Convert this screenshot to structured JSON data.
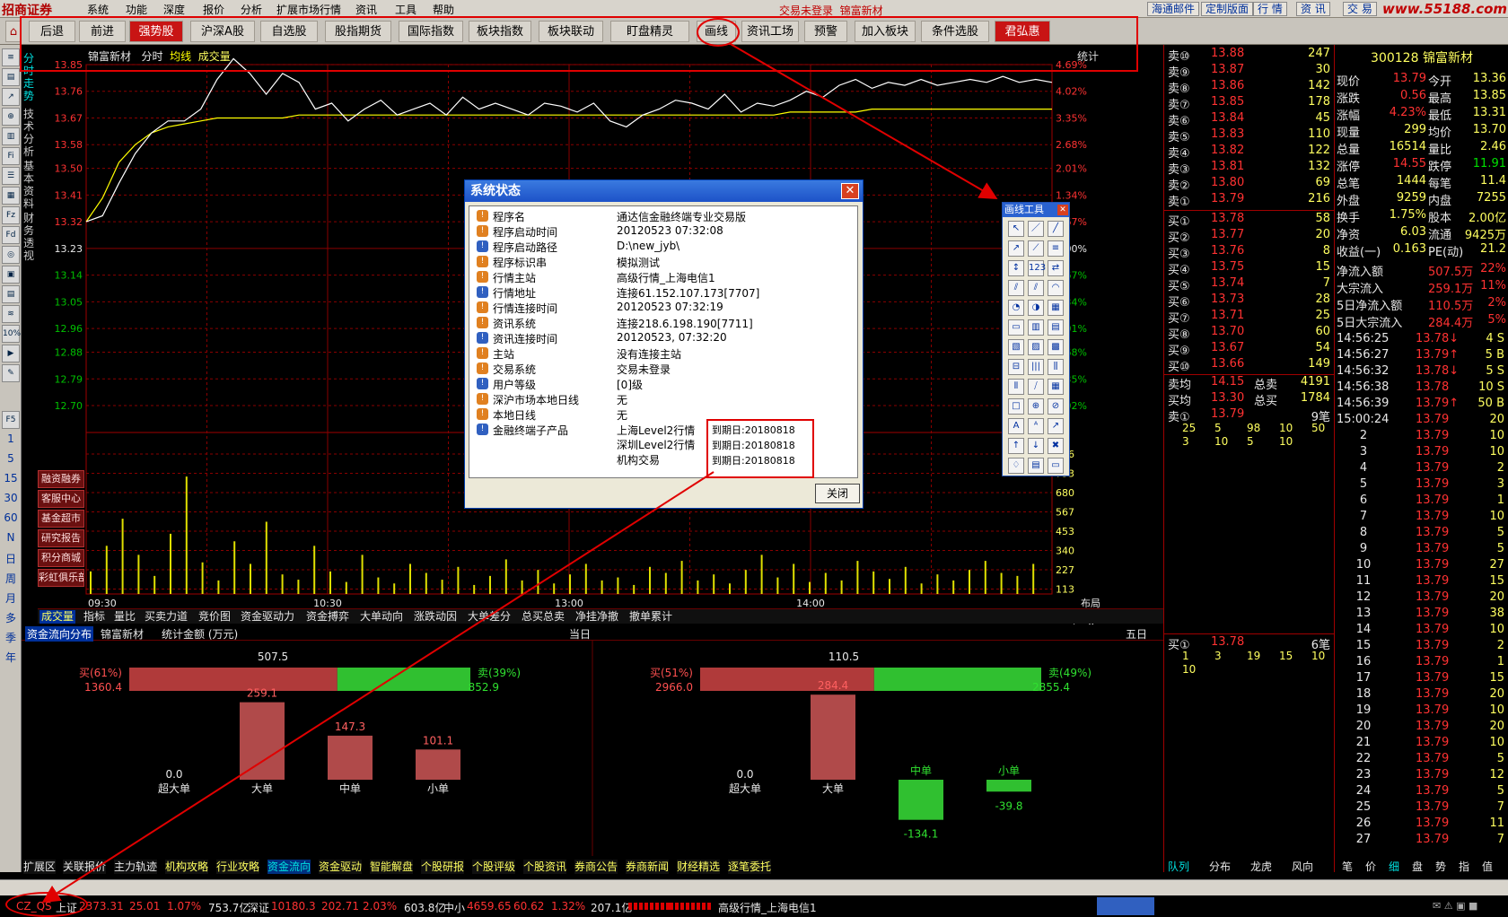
{
  "app": {
    "logo": "招商证券",
    "watermark": "www.55188.com",
    "trade_status": "交易未登录",
    "stock_title": "锦富新材"
  },
  "menu": [
    "系统",
    "功能",
    "深度",
    "报价",
    "分析",
    "扩展市场行情",
    "资讯",
    "工具",
    "帮助"
  ],
  "top_right_buttons": [
    "海通邮件",
    "定制版面",
    "行 情",
    "资 讯",
    "交 易"
  ],
  "toolbar": [
    "后退",
    "前进",
    "强势股",
    "沪深A股",
    "自选股",
    "股指期货",
    "国际指数",
    "板块指数",
    "板块联动",
    "盯盘精灵",
    "画线",
    "资讯工场",
    "预警",
    "加入板块",
    "条件选股",
    "君弘惠"
  ],
  "left_vertical_tabs": [
    "分时走势",
    "技术分析",
    "基本资料",
    "财务透视"
  ],
  "left_sidebar_letters": [
    "1",
    "5",
    "15",
    "30",
    "60",
    "N",
    "日",
    "周",
    "月",
    "多",
    "季",
    "年"
  ],
  "left_service_buttons": [
    "融资融券",
    "客服中心",
    "基金超市",
    "研究报告",
    "积分商城",
    "彩虹俱乐部"
  ],
  "chart_header": {
    "name": "锦富新材",
    "mode": "分时",
    "avg": "均线",
    "vol": "成交量",
    "stat": "统计"
  },
  "chart_data": {
    "type": "line",
    "price_ticks": [
      "13.85",
      "13.76",
      "13.67",
      "13.58",
      "13.50",
      "13.41",
      "13.32",
      "13.23",
      "13.14",
      "13.05",
      "12.96",
      "12.88",
      "12.79",
      "12.70"
    ],
    "pct_ticks": [
      "4.69%",
      "4.02%",
      "3.35%",
      "2.68%",
      "2.01%",
      "1.34%",
      "0.67%",
      "0.00%",
      "0.67%",
      "1.34%",
      "2.01%",
      "2.68%",
      "3.35%",
      "4.02%"
    ],
    "vol_ticks": [
      "906",
      "793",
      "680",
      "567",
      "453",
      "340",
      "227",
      "113"
    ],
    "x_ticks": [
      "09:30",
      "10:30",
      "13:00",
      "14:00"
    ],
    "layout_label": "布局",
    "price_y": [
      13.32,
      13.34,
      13.45,
      13.55,
      13.62,
      13.66,
      13.66,
      13.7,
      13.8,
      13.87,
      13.82,
      13.75,
      13.82,
      13.79,
      13.7,
      13.72,
      13.66,
      13.7,
      13.73,
      13.68,
      13.7,
      13.72,
      13.68,
      13.74,
      13.7,
      13.72,
      13.7,
      13.68,
      13.72,
      13.71,
      13.69,
      13.72,
      13.66,
      13.64,
      13.68,
      13.7,
      13.73,
      13.72,
      13.7,
      13.75,
      13.69,
      13.72,
      13.71,
      13.73,
      13.76,
      13.74,
      13.78,
      13.8,
      13.77,
      13.79,
      13.78,
      13.8,
      13.78,
      13.79,
      13.8,
      13.79,
      13.81,
      13.79,
      13.8,
      13.79
    ],
    "avg_y": [
      13.32,
      13.4,
      13.52,
      13.58,
      13.62,
      13.64,
      13.65,
      13.66,
      13.67,
      13.67,
      13.67,
      13.67,
      13.67,
      13.68,
      13.68,
      13.68,
      13.68,
      13.68,
      13.68,
      13.68,
      13.68,
      13.68,
      13.68,
      13.68,
      13.68,
      13.68,
      13.68,
      13.68,
      13.68,
      13.68,
      13.68,
      13.68,
      13.68,
      13.68,
      13.68,
      13.68,
      13.68,
      13.68,
      13.68,
      13.68,
      13.68,
      13.68,
      13.68,
      13.69,
      13.69,
      13.69,
      13.69,
      13.69,
      13.7,
      13.7,
      13.7,
      13.7,
      13.7,
      13.7,
      13.7,
      13.7,
      13.7,
      13.7,
      13.7,
      13.7
    ],
    "volume": [
      150,
      320,
      500,
      260,
      120,
      400,
      780,
      210,
      90,
      350,
      200,
      480,
      130,
      95,
      320,
      150,
      80,
      260,
      110,
      70,
      200,
      140,
      95,
      180,
      60,
      120,
      230,
      90,
      160,
      70,
      130,
      200,
      90,
      110,
      60,
      180,
      140,
      220,
      90,
      130,
      70,
      160,
      260,
      110,
      200,
      80,
      140,
      90,
      220,
      150,
      100,
      180,
      70,
      130,
      90,
      160,
      220,
      140,
      120,
      200
    ]
  },
  "indicator_tabs": [
    "成交量",
    "指标",
    "量比",
    "买卖力道",
    "竞价图",
    "资金驱动力",
    "资金搏弈",
    "大单动向",
    "涨跌动因",
    "大单差分",
    "总买总卖",
    "净挂净撤",
    "撤单累计"
  ],
  "fund_flow": {
    "header": [
      "资金流向分布",
      "锦富新材",
      "统计金额 (万元)"
    ],
    "today": "当日",
    "five_day": "五日",
    "panel1": {
      "top": "507.5",
      "buy_label": "买(61%)",
      "buy_val": "1360.4",
      "sell_label": "卖(39%)",
      "sell_val": "852.9",
      "buy_frac": 0.61,
      "cats": [
        "超大单",
        "大单",
        "中单",
        "小单"
      ],
      "vals": [
        "0.0",
        "259.1",
        "147.3",
        "101.1"
      ],
      "nums": [
        0,
        259.1,
        147.3,
        101.1
      ]
    },
    "panel2": {
      "top": "110.5",
      "buy_label": "买(51%)",
      "buy_val": "2966.0",
      "sell_label": "卖(49%)",
      "sell_val": "2855.4",
      "buy_frac": 0.51,
      "cats": [
        "超大单",
        "大单",
        "中单",
        "小单"
      ],
      "vals": [
        "0.0",
        "284.4",
        "-134.1",
        "-39.8"
      ],
      "nums": [
        0,
        284.4,
        -134.1,
        -39.8
      ]
    }
  },
  "bottom_tabs": [
    "扩展区",
    "关联报价",
    "主力轨迹",
    "机构攻略",
    "行业攻略",
    "资金流向",
    "资金驱动",
    "智能解盘",
    "个股研报",
    "个股评级",
    "个股资讯",
    "券商公告",
    "券商新闻",
    "财经精选",
    "逐笔委托"
  ],
  "order_book": {
    "asks": [
      [
        "卖⑩",
        "13.88",
        "247"
      ],
      [
        "卖⑨",
        "13.87",
        "30"
      ],
      [
        "卖⑧",
        "13.86",
        "142"
      ],
      [
        "卖⑦",
        "13.85",
        "178"
      ],
      [
        "卖⑥",
        "13.84",
        "45"
      ],
      [
        "卖⑤",
        "13.83",
        "110"
      ],
      [
        "卖④",
        "13.82",
        "122"
      ],
      [
        "卖③",
        "13.81",
        "132"
      ],
      [
        "卖②",
        "13.80",
        "69"
      ],
      [
        "卖①",
        "13.79",
        "216"
      ]
    ],
    "bids": [
      [
        "买①",
        "13.78",
        "58"
      ],
      [
        "买②",
        "13.77",
        "20"
      ],
      [
        "买③",
        "13.76",
        "8"
      ],
      [
        "买④",
        "13.75",
        "15"
      ],
      [
        "买⑤",
        "13.74",
        "7"
      ],
      [
        "买⑥",
        "13.73",
        "28"
      ],
      [
        "买⑦",
        "13.71",
        "25"
      ],
      [
        "买⑧",
        "13.70",
        "60"
      ],
      [
        "买⑨",
        "13.67",
        "54"
      ],
      [
        "买⑩",
        "13.66",
        "149"
      ]
    ],
    "avg_sell": [
      "卖均",
      "14.15",
      "总卖",
      "4191"
    ],
    "avg_buy": [
      "买均",
      "13.30",
      "总买",
      "1784"
    ],
    "sell1_row": [
      "卖①",
      "13.79",
      "9笔"
    ],
    "sell1_detail1": [
      "25",
      "5",
      "98",
      "10",
      "50"
    ],
    "sell1_detail2": [
      "3",
      "10",
      "5",
      "10"
    ],
    "buy1_row": [
      "买①",
      "13.78",
      "6笔"
    ],
    "buy1_detail1": [
      "1",
      "3",
      "19",
      "15",
      "10"
    ],
    "buy1_detail2": [
      "10"
    ]
  },
  "quote": {
    "code_name": "300128 锦富新材",
    "rows": [
      [
        "现价",
        "13.79",
        "今开",
        "13.36"
      ],
      [
        "涨跌",
        "0.56",
        "最高",
        "13.85"
      ],
      [
        "涨幅",
        "4.23%",
        "最低",
        "13.31"
      ],
      [
        "现量",
        "299",
        "均价",
        "13.70"
      ],
      [
        "总量",
        "16514",
        "量比",
        "2.46"
      ],
      [
        "涨停",
        "14.55",
        "跌停",
        "11.91"
      ],
      [
        "总笔",
        "1444",
        "每笔",
        "11.4"
      ],
      [
        "外盘",
        "9259",
        "内盘",
        "7255"
      ],
      [
        "换手",
        "1.75%",
        "股本",
        "2.00亿"
      ],
      [
        "净资",
        "6.03",
        "流通",
        "9425万"
      ],
      [
        "收益(一)",
        "0.163",
        "PE(动)",
        "21.2"
      ]
    ],
    "flow_rows": [
      [
        "净流入额",
        "507.5万",
        "22%"
      ],
      [
        "大宗流入",
        "259.1万",
        "11%"
      ],
      [
        "5日净流入额",
        "110.5万",
        "2%"
      ],
      [
        "5日大宗流入",
        "284.4万",
        "5%"
      ]
    ]
  },
  "ticks": [
    [
      "14:56:25",
      "13.78↓",
      "4 S"
    ],
    [
      "14:56:27",
      "13.79↑",
      "5 B"
    ],
    [
      "14:56:32",
      "13.78↓",
      "5 S"
    ],
    [
      "14:56:38",
      "13.78",
      "10 S"
    ],
    [
      "14:56:39",
      "13.79↑",
      "50 B"
    ],
    [
      "15:00:24",
      "13.79",
      "20"
    ],
    [
      "2",
      "13.79",
      "10"
    ],
    [
      "3",
      "13.79",
      "10"
    ],
    [
      "4",
      "13.79",
      "2"
    ],
    [
      "5",
      "13.79",
      "3"
    ],
    [
      "6",
      "13.79",
      "1"
    ],
    [
      "7",
      "13.79",
      "10"
    ],
    [
      "8",
      "13.79",
      "5"
    ],
    [
      "9",
      "13.79",
      "5"
    ],
    [
      "10",
      "13.79",
      "27"
    ],
    [
      "11",
      "13.79",
      "15"
    ],
    [
      "12",
      "13.79",
      "20"
    ],
    [
      "13",
      "13.79",
      "38"
    ],
    [
      "14",
      "13.79",
      "10"
    ],
    [
      "15",
      "13.79",
      "2"
    ],
    [
      "16",
      "13.79",
      "1"
    ],
    [
      "17",
      "13.79",
      "15"
    ],
    [
      "18",
      "13.79",
      "20"
    ],
    [
      "19",
      "13.79",
      "10"
    ],
    [
      "20",
      "13.79",
      "20"
    ],
    [
      "21",
      "13.79",
      "10"
    ],
    [
      "22",
      "13.79",
      "5"
    ],
    [
      "23",
      "13.79",
      "12"
    ],
    [
      "24",
      "13.79",
      "5"
    ],
    [
      "25",
      "13.79",
      "7"
    ],
    [
      "26",
      "13.79",
      "11"
    ],
    [
      "27",
      "13.79",
      "7"
    ]
  ],
  "right_bottom_tabs": [
    "队列",
    "分布",
    "龙虎",
    "风向"
  ],
  "far_right_tabs": [
    "笔",
    "价",
    "细",
    "盘",
    "势",
    "指",
    "值"
  ],
  "status_bar": {
    "label": "CZ_QS",
    "sh": "上证",
    "sh_val": "2373.31",
    "sh_chg": "25.01",
    "sh_pct": "1.07%",
    "sh_amt": "753.7亿",
    "sz": "深证",
    "sz_val": "10180.3",
    "sz_chg": "202.71",
    "sz_pct": "2.03%",
    "sz_amt": "603.8亿",
    "zx": "中小",
    "zx_val": "4659.65",
    "zx_chg": "60.62",
    "zx_pct": "1.32%",
    "zx_amt": "207.1亿",
    "hq": "高级行情_上海电信1"
  },
  "dialog": {
    "title": "系统状态",
    "rows": [
      [
        "程序名",
        "通达信金融终端专业交易版"
      ],
      [
        "程序启动时间",
        "20120523  07:32:08"
      ],
      [
        "程序启动路径",
        "D:\\new_jyb\\"
      ],
      [
        "程序标识串",
        "模拟测试"
      ],
      [
        "行情主站",
        "高级行情_上海电信1"
      ],
      [
        "行情地址",
        "连接61.152.107.173[7707]"
      ],
      [
        "行情连接时间",
        "20120523  07:32:19"
      ],
      [
        "资讯系统",
        "连接218.6.198.190[7711]"
      ],
      [
        "资讯连接时间",
        "20120523, 07:32:20"
      ],
      [
        "主站",
        "没有连接主站"
      ],
      [
        "交易系统",
        "交易未登录"
      ],
      [
        "用户等级",
        "[0]级"
      ],
      [
        "深沪市场本地日线",
        "无"
      ],
      [
        "本地日线",
        "无"
      ],
      [
        "金融终端子产品",
        "上海Level2行情"
      ]
    ],
    "extra": [
      [
        "深圳Level2行情"
      ],
      [
        "机构交易"
      ]
    ],
    "expiry": [
      "到期日:20180818",
      "到期日:20180818",
      "到期日:20180818"
    ],
    "close": "关闭"
  },
  "draw_tool": {
    "title": "画线工具"
  }
}
